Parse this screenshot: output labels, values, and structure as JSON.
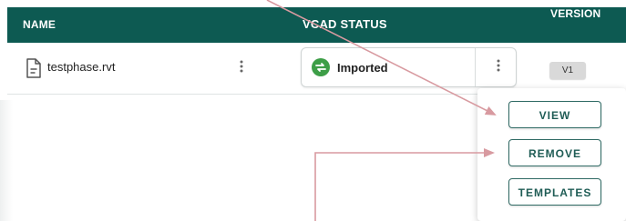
{
  "table": {
    "headers": {
      "name": "NAME",
      "status": "VCAD STATUS",
      "version": "VERSION"
    },
    "rows": [
      {
        "file_icon": "document-icon",
        "file_name": "testphase.rvt",
        "status_icon": "sync-arrows-icon",
        "status": "Imported",
        "version": "V1"
      }
    ]
  },
  "context_menu": {
    "items": [
      {
        "label": "VIEW"
      },
      {
        "label": "REMOVE"
      },
      {
        "label": "TEMPLATES"
      }
    ]
  },
  "icons": {
    "more": "more-vertical-icon"
  },
  "colors": {
    "header_bg": "#0d5a52",
    "header_text": "#ffffff",
    "status_green": "#3d9e47",
    "menu_button_border": "#2f6a64",
    "menu_button_text": "#1f5c55",
    "annotation_arrow": "#d89aa0"
  }
}
